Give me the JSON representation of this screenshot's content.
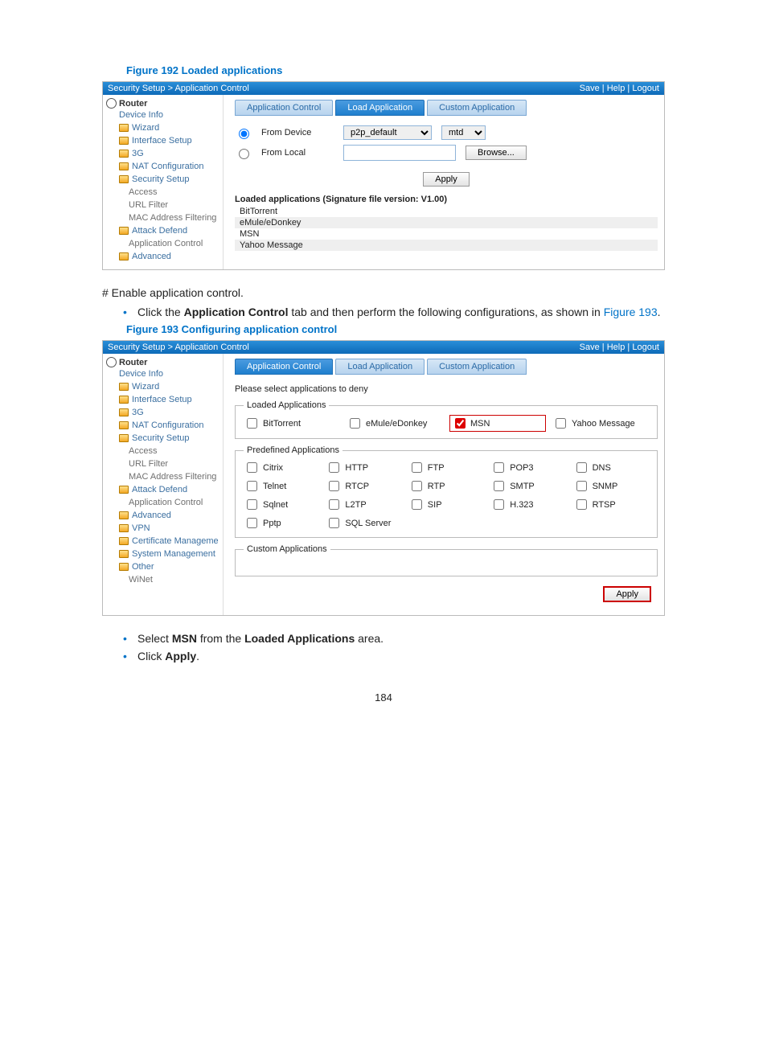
{
  "figure192": {
    "caption": "Figure 192 Loaded applications",
    "breadcrumb": "Security Setup > Application Control",
    "toplinks": {
      "save": "Save",
      "help": "Help",
      "logout": "Logout"
    },
    "nav": {
      "root": "Router",
      "items": [
        "Device Info",
        "Wizard",
        "Interface Setup",
        "3G",
        "NAT Configuration",
        "Security Setup"
      ],
      "sub": [
        "Access",
        "URL Filter",
        "MAC Address Filtering",
        "Attack Defend",
        "Application Control"
      ],
      "tail": [
        "Advanced"
      ]
    },
    "tabs": {
      "t1": "Application Control",
      "t2": "Load Application",
      "t3": "Custom Application"
    },
    "form": {
      "from_device": "From Device",
      "from_local": "From Local",
      "dropdown_value": "p2p_default",
      "ext": "mtd",
      "browse": "Browse...",
      "apply": "Apply"
    },
    "loaded_title": "Loaded applications (Signature file version: V1.00)",
    "loaded_rows": [
      "BitTorrent",
      "eMule/eDonkey",
      "MSN",
      "Yahoo Message"
    ]
  },
  "between": {
    "hash": "# Enable application control.",
    "bullet1a": "Click the ",
    "bullet1b": "Application Control",
    "bullet1c": " tab and then perform the following configurations, as shown in ",
    "link": "Figure 193",
    "period": "."
  },
  "figure193": {
    "caption": "Figure 193 Configuring application control",
    "breadcrumb": "Security Setup > Application Control",
    "toplinks": {
      "save": "Save",
      "help": "Help",
      "logout": "Logout"
    },
    "nav": {
      "root": "Router",
      "items1": [
        "Device Info",
        "Wizard",
        "Interface Setup",
        "3G",
        "NAT Configuration",
        "Security Setup"
      ],
      "sub": [
        "Access",
        "URL Filter",
        "MAC Address Filtering",
        "Attack Defend",
        "Application Control"
      ],
      "items2": [
        "Advanced",
        "VPN",
        "Certificate Manageme",
        "System Management",
        "Other",
        "WiNet"
      ]
    },
    "tabs": {
      "t1": "Application Control",
      "t2": "Load Application",
      "t3": "Custom Application"
    },
    "prompt": "Please select applications to deny",
    "legend_loaded": "Loaded Applications",
    "loaded": {
      "bt": "BitTorrent",
      "emule": "eMule/eDonkey",
      "msn": "MSN",
      "yahoo": "Yahoo Message"
    },
    "legend_predef": "Predefined Applications",
    "predef": {
      "r1": [
        "Citrix",
        "HTTP",
        "FTP",
        "POP3",
        "DNS"
      ],
      "r2": [
        "Telnet",
        "RTCP",
        "RTP",
        "SMTP",
        "SNMP"
      ],
      "r3": [
        "Sqlnet",
        "L2TP",
        "SIP",
        "H.323",
        "RTSP"
      ],
      "r4": [
        "Pptp",
        "SQL Server"
      ]
    },
    "legend_custom": "Custom Applications",
    "apply": "Apply"
  },
  "after": {
    "b1a": "Select ",
    "b1b": "MSN",
    "b1c": " from the ",
    "b1d": "Loaded Applications",
    "b1e": " area.",
    "b2a": "Click ",
    "b2b": "Apply",
    "b2c": "."
  },
  "page_number": "184"
}
